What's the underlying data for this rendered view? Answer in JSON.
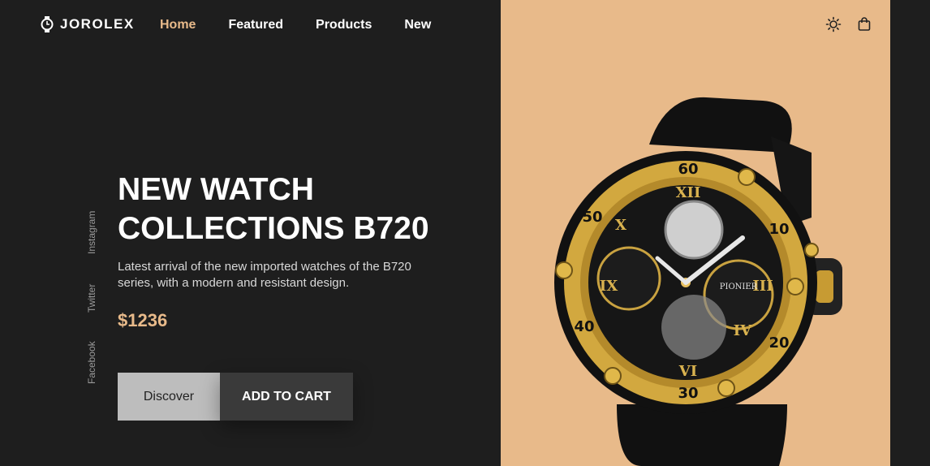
{
  "brand": {
    "name": "JOROLEX",
    "icon": "watch-logo-icon"
  },
  "nav": {
    "items": [
      {
        "label": "Home",
        "active": true
      },
      {
        "label": "Featured",
        "active": false
      },
      {
        "label": "Products",
        "active": false
      },
      {
        "label": "New",
        "active": false
      }
    ]
  },
  "header_icons": [
    "sun-icon",
    "shopping-bag-icon"
  ],
  "social": {
    "items": [
      "Instagram",
      "Twitter",
      "Facebook"
    ]
  },
  "hero": {
    "title_line1": "NEW WATCH",
    "title_line2": "COLLECTIONS B720",
    "description": "Latest arrival of the new imported watches of the B720 series, with a modern and resistant design.",
    "price": "$1236",
    "discover_label": "Discover",
    "cart_label": "ADD TO CART"
  },
  "colors": {
    "background": "#1e1e1e",
    "accent": "#e8ba8a",
    "panel": "#e8ba8a"
  }
}
